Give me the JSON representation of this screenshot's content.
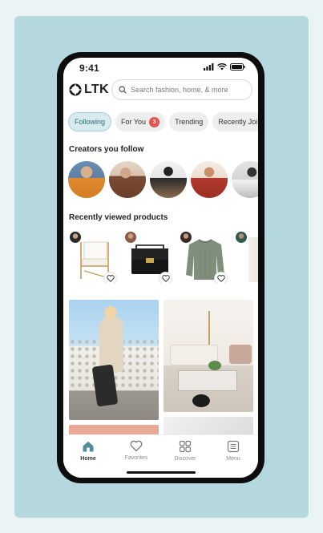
{
  "colors": {
    "background": "#eaf4f5",
    "panel": "#b5d8de",
    "accent": "#2c6d78",
    "badge": "#e2544e"
  },
  "status_bar": {
    "time": "9:41",
    "icons": [
      "signal-icon",
      "wifi-icon",
      "battery-icon"
    ]
  },
  "header": {
    "logo_text": "LTK",
    "search_placeholder": "Search fashion, home, & more"
  },
  "filter_chips": [
    {
      "label": "Following",
      "active": true
    },
    {
      "label": "For You",
      "badge": "3"
    },
    {
      "label": "Trending"
    },
    {
      "label": "Recently Joi"
    }
  ],
  "creators_section": {
    "title": "Creators you follow",
    "creators": [
      "creator-1",
      "creator-2",
      "creator-3",
      "creator-4",
      "creator-5"
    ]
  },
  "products_section": {
    "title": "Recently viewed products",
    "products": [
      "white-accent-chair",
      "black-leather-handbag",
      "green-knit-sweater",
      "white-item"
    ]
  },
  "tab_bar": {
    "tabs": [
      {
        "label": "Home",
        "icon": "home-icon",
        "active": true
      },
      {
        "label": "Favorites",
        "icon": "heart-icon"
      },
      {
        "label": "Discover",
        "icon": "grid-icon"
      },
      {
        "label": "Menu",
        "icon": "menu-icon"
      }
    ]
  }
}
